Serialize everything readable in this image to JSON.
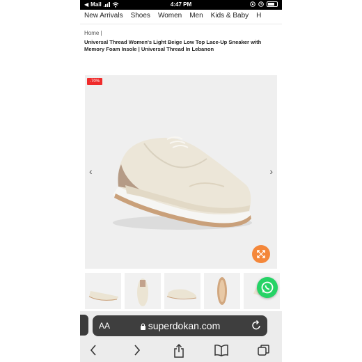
{
  "status_bar": {
    "carrier": "Mail",
    "time": "4:47 PM"
  },
  "nav": {
    "items": [
      "New Arrivals",
      "Shoes",
      "Women",
      "Men",
      "Kids & Baby",
      "H"
    ]
  },
  "breadcrumb": "Home  |",
  "product": {
    "title": "Universal Thread Women's Light Beige Low Top Lace-Up Sneaker with Memory Foam Insole | Universal Thread In Lebanon",
    "discount_badge": "-70%"
  },
  "gallery": {
    "prev_icon": "chevron-left-icon",
    "next_icon": "chevron-right-icon",
    "thumbnail_count": 5
  },
  "browser": {
    "text_size_label": "AA",
    "url": "superdokan.com"
  },
  "colors": {
    "badge": "#ef2b2b",
    "expand_button": "#f4873a",
    "whatsapp": "#25d366"
  }
}
